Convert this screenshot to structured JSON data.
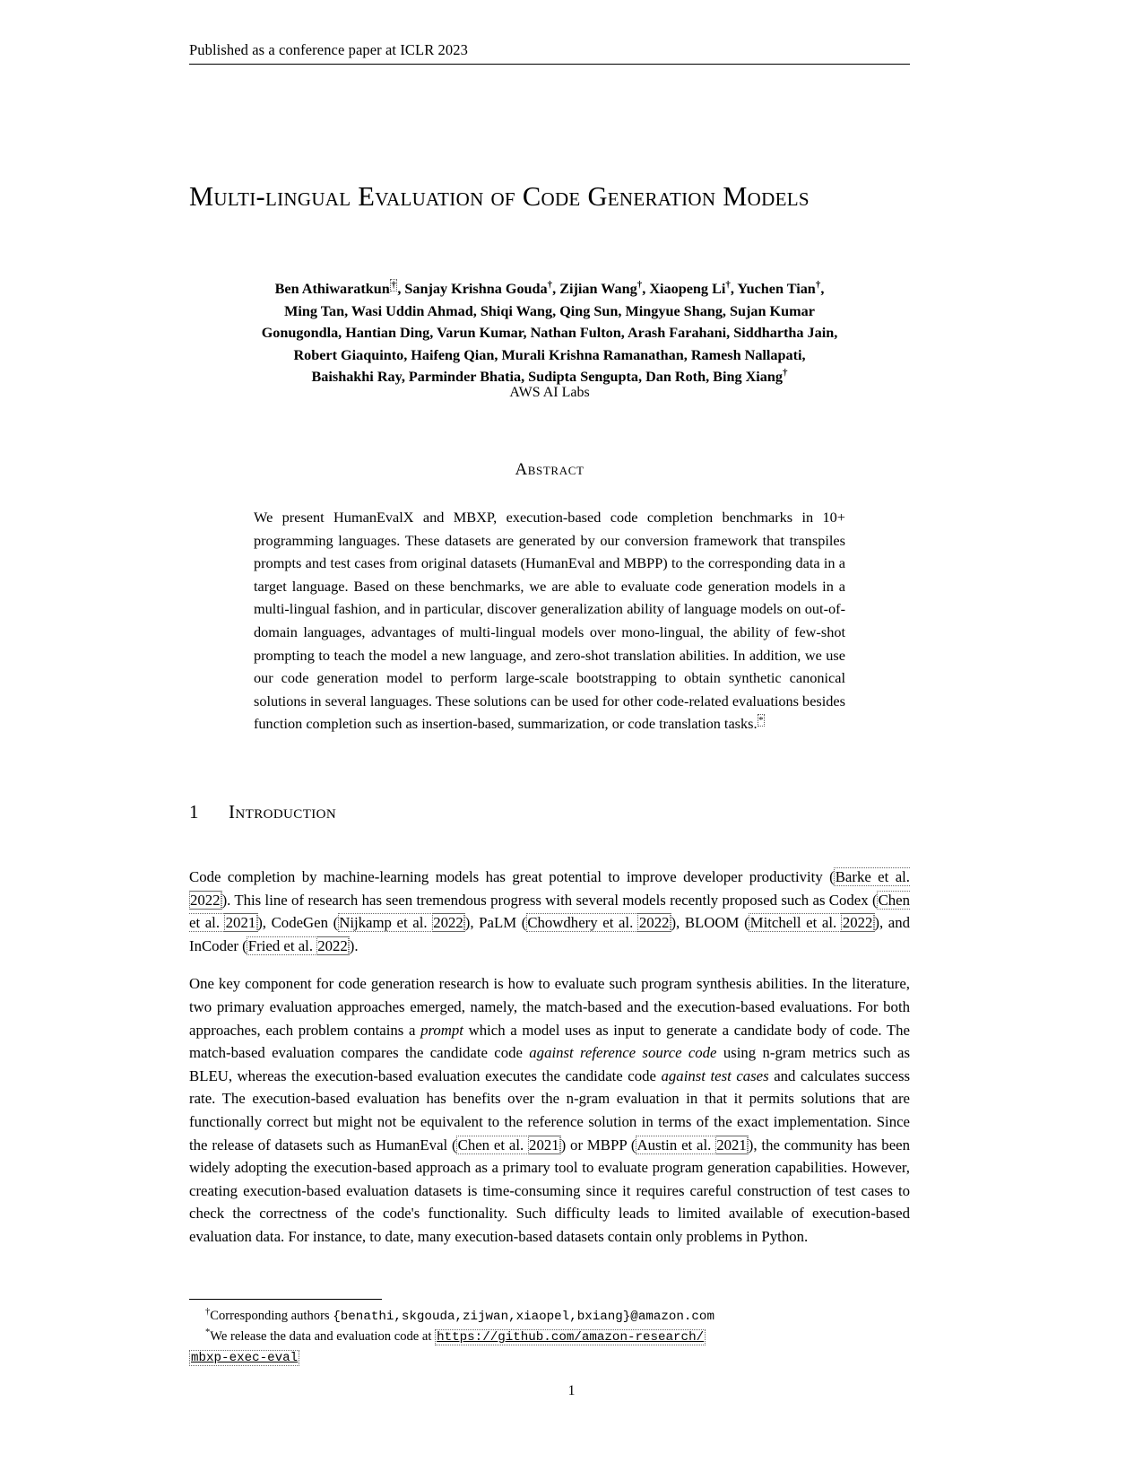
{
  "running_header": "Published as a conference paper at ICLR 2023",
  "title": {
    "line1": "Multi-lingual Evaluation of Code Generation",
    "line2": "Models"
  },
  "authors": {
    "line1_a": "Ben Athiwaratkun",
    "line1_dagger": "†",
    "line1_b": ", Sanjay Krishna Gouda",
    "line1_c": ", Zijian Wang",
    "line1_d": ", Xiaopeng Li",
    "line1_e": ", Yuchen Tian",
    "line1_f": ",",
    "line2": "Ming Tan,  Wasi Uddin Ahmad,  Shiqi Wang,   Qing Sun,  Mingyue Shang,  Sujan Kumar",
    "line3": "Gonugondla,  Hantian Ding,  Varun Kumar,  Nathan Fulton,  Arash Farahani, Siddhartha Jain,",
    "line4": "Robert Giaquinto,  Haifeng Qian,  Murali Krishna Ramanathan, Ramesh Nallapati,",
    "line5_a": "Baishakhi Ray,  Parminder Bhatia,  Sudipta Sengupta,  Dan Roth,  Bing Xiang",
    "line5_dagger": "†",
    "affiliation": "AWS AI Labs"
  },
  "abstract": {
    "heading": "Abstract",
    "text": "We present HumanEvalX and MBXP, execution-based code completion benchmarks in 10+ programming languages. These datasets are generated by our conversion framework that transpiles prompts and test cases from original datasets (HumanEval and MBPP) to the corresponding data in a target language. Based on these benchmarks, we are able to evaluate code generation models in a multi-lingual fashion, and in particular, discover generalization ability of language models on out-of-domain languages, advantages of multi-lingual models over mono-lingual, the ability of few-shot prompting to teach the model a new language, and zero-shot translation abilities. In addition, we use our code generation model to perform large-scale bootstrapping to obtain synthetic canonical solutions in several languages. These solutions can be used for other code-related evaluations besides function completion such as insertion-based, summarization, or code translation tasks.",
    "footnote_marker": "*"
  },
  "section": {
    "number": "1",
    "title": "Introduction"
  },
  "paragraphs": {
    "p1": {
      "seg1": "Code completion by machine-learning models has great potential to improve developer productivity (",
      "cite1": "Barke et al.",
      "cite1_year": "2022",
      "seg2": "). This line of research has seen tremendous progress with several models recently proposed such as Codex (",
      "cite2": "Chen et al.",
      "cite2_year": "2021",
      "seg3": "), CodeGen (",
      "cite3": "Nijkamp et al.",
      "cite3_year": "2022",
      "seg4": "), PaLM (",
      "cite4": "Chowdhery et al.",
      "cite4_year": "2022",
      "seg5": "), BLOOM (",
      "cite5": "Mitchell et al.",
      "cite5_year": "2022",
      "seg6": "), and InCoder (",
      "cite6": "Fried et al.",
      "cite6_year": "2022",
      "seg7": ")."
    },
    "p2": {
      "seg1": "One key component for code generation research is how to evaluate such program synthesis abilities. In the literature, two primary evaluation approaches emerged, namely, the match-based and the execution-based evaluations. For both approaches, each problem contains a ",
      "em1": "prompt",
      "seg2": " which a model uses as input to generate a candidate body of code. The match-based evaluation compares the candidate code ",
      "em2": "against reference source code",
      "seg3": " using n-gram metrics such as BLEU, whereas the execution-based evaluation executes the candidate code ",
      "em3": "against test cases",
      "seg4": " and calculates success rate. The execution-based evaluation has benefits over the n-gram evaluation in that it permits solutions that are functionally correct but might not be equivalent to the reference solution in terms of the exact implementation. Since the release of datasets such as HumanEval (",
      "cite1": "Chen et al.",
      "cite1_year": "2021",
      "seg5": ") or MBPP (",
      "cite2": "Austin et al.",
      "cite2_year": "2021",
      "seg6": "), the community has been widely adopting the execution-based approach as a primary tool to evaluate program generation capabilities. However, creating execution-based evaluation datasets is time-consuming since it requires careful construction of test cases to check the correctness of the code's functionality. Such difficulty leads to limited available of execution-based evaluation data. For instance, to date, many execution-based datasets contain only problems in Python."
    }
  },
  "footnotes": {
    "fn1_marker": "†",
    "fn1_text": "Corresponding authors ",
    "fn1_mono": "{benathi,skgouda,zijwan,xiaopel,bxiang}@amazon.com",
    "fn2_marker": "*",
    "fn2_text": "We  release  the  data  and  evaluation  code  at ",
    "fn2_url_line1": "https://github.com/amazon-research/",
    "fn2_url_line2": "mbxp-exec-eval"
  },
  "page_number": "1"
}
